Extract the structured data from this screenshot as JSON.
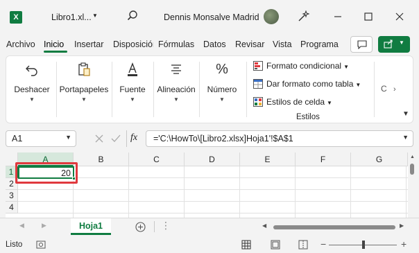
{
  "titlebar": {
    "app_logo_letter": "X",
    "doc_title": "Libro1.xl...",
    "user_name": "Dennis Monsalve Madrid"
  },
  "menu": {
    "tabs": [
      "Archivo",
      "Inicio",
      "Insertar",
      "Disposición",
      "Fórmulas",
      "Datos",
      "Revisar",
      "Vista",
      "Programa"
    ],
    "active_tab": "Inicio"
  },
  "ribbon": {
    "groups": {
      "deshacer": "Deshacer",
      "portapapeles": "Portapapeles",
      "fuente": "Fuente",
      "alineacion": "Alineación",
      "numero": "Número"
    },
    "estilos": {
      "formato_condicional": "Formato condicional",
      "dar_formato": "Dar formato como tabla",
      "estilos_celda": "Estilos de celda",
      "group_label": "Estilos"
    },
    "more_label": "C"
  },
  "formula_bar": {
    "name_box": "A1",
    "fx_label": "fx",
    "formula": "='C:\\HowTo\\[Libro2.xlsx]Hoja1'!$A$1"
  },
  "grid": {
    "columns": [
      "A",
      "B",
      "C",
      "D",
      "E",
      "F",
      "G"
    ],
    "rows": [
      "1",
      "2",
      "3",
      "4"
    ],
    "cell_a1": "20"
  },
  "sheets": {
    "active": "Hoja1"
  },
  "status": {
    "text": "Listo"
  },
  "colors": {
    "accent": "#107c41",
    "highlight": "#e0393e"
  }
}
